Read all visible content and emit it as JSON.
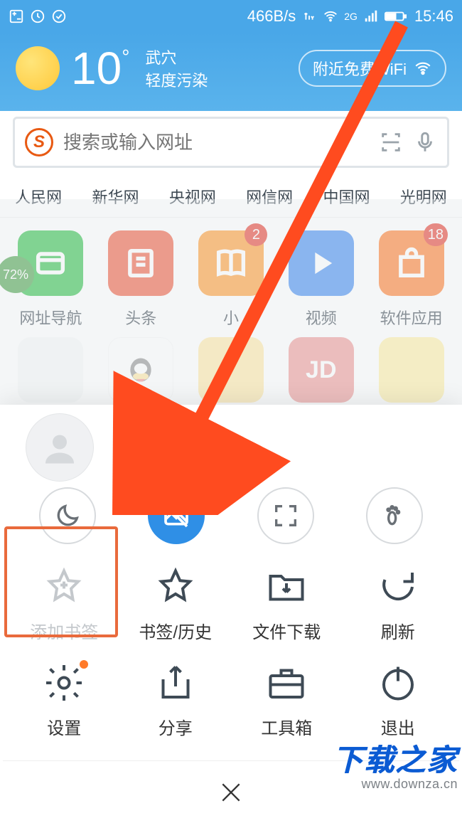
{
  "status": {
    "speed": "466B/s",
    "net_label": "2G",
    "time": "15:46"
  },
  "weather": {
    "temp": "10",
    "city": "武穴",
    "aqi": "轻度污染"
  },
  "wifi_button": "附近免费WiFi",
  "search": {
    "placeholder": "搜索或输入网址"
  },
  "quicklinks": [
    "人民网",
    "新华网",
    "央视网",
    "网信网",
    "中国网",
    "光明网"
  ],
  "apps_row1": [
    {
      "label": "网址导航",
      "color": "#2fbf47",
      "badge": "",
      "progress": "72%"
    },
    {
      "label": "头条",
      "color": "#ef5a3c",
      "badge": ""
    },
    {
      "label": "小说",
      "color": "#ff9a2e",
      "badge": "2"
    },
    {
      "label": "视频",
      "color": "#3f89f0",
      "badge": ""
    },
    {
      "label": "软件应用",
      "color": "#ff7a29",
      "badge": "18"
    }
  ],
  "circle_row": [
    {
      "name": "night-mode",
      "active": false
    },
    {
      "name": "no-image",
      "active": true
    },
    {
      "name": "fullscreen",
      "active": false
    },
    {
      "name": "incognito",
      "active": false
    }
  ],
  "menu": [
    {
      "label": "添加书签",
      "disabled": true
    },
    {
      "label": "书签/历史",
      "disabled": false
    },
    {
      "label": "文件下载",
      "disabled": false
    },
    {
      "label": "刷新",
      "disabled": false
    },
    {
      "label": "设置",
      "disabled": false,
      "dot": true
    },
    {
      "label": "分享",
      "disabled": false
    },
    {
      "label": "工具箱",
      "disabled": false
    },
    {
      "label": "退出",
      "disabled": false
    }
  ],
  "watermark": {
    "title": "下载之家",
    "url": "www.downza.cn"
  }
}
